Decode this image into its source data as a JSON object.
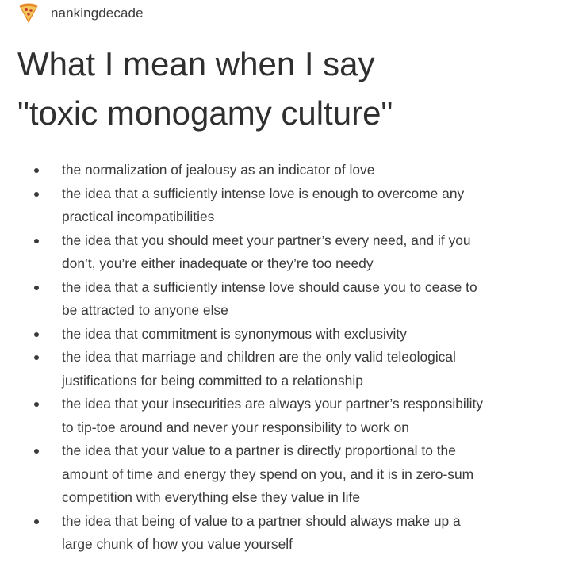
{
  "header": {
    "username": "nankingdecade",
    "avatar_icon": "pizza-slice-icon",
    "avatar_colors": {
      "crust": "#e48a2b",
      "cheese": "#f4c55a",
      "pepperoni": "#c0392b"
    }
  },
  "title": {
    "line1": "What I mean when I say",
    "line2": "\"toxic monogamy culture\""
  },
  "items": [
    {
      "line1": "the normalization of jealousy as an indicator of love"
    },
    {
      "line1": "the idea that a sufficiently intense love is enough to overcome any",
      "line2": "practical incompatibilities"
    },
    {
      "line1": "the idea that you should meet your partner’s every need, and if you",
      "line2": "don’t, you’re either inadequate or they’re too needy"
    },
    {
      "line1": "the idea that a sufficiently intense love should cause you to cease to",
      "line2": "be attracted to anyone else"
    },
    {
      "line1": "the idea that commitment is synonymous with exclusivity"
    },
    {
      "line1": "the idea that marriage and children are the only valid teleological",
      "line2": "justifications for being committed to a relationship"
    },
    {
      "line1": "the idea that your insecurities are always your partner’s responsibility",
      "line2": "to tip-toe around and never your responsibility to work on"
    },
    {
      "line1": "the idea that your value to a partner is directly proportional to the",
      "line2": "amount of time and energy they spend on you, and it is in zero-sum",
      "line3": "competition with everything else they value in life"
    },
    {
      "line1": "the idea that being of value to a partner should always make up a",
      "line2": "large chunk of how you value yourself"
    }
  ]
}
